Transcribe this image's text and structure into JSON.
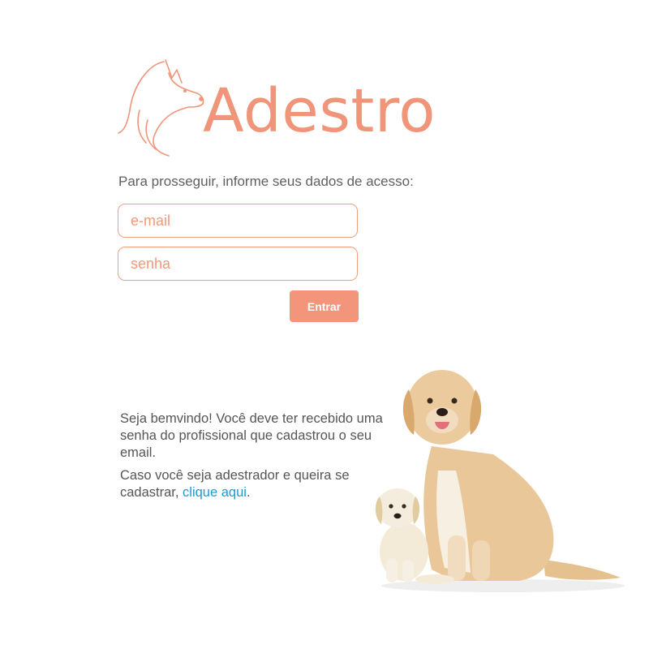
{
  "brand": {
    "name": "Adestro",
    "color": "#f0957a",
    "logo_icon": "dog-head-outline-icon"
  },
  "login": {
    "prompt": "Para prosseguir, informe seus dados de acesso:",
    "email": {
      "value": "",
      "placeholder": "e-mail"
    },
    "password": {
      "value": "",
      "placeholder": "senha"
    },
    "submit_label": "Entrar"
  },
  "welcome": {
    "paragraph1": "Seja bemvindo! Você deve ter recebido uma senha do profissional que cadastrou o seu email.",
    "paragraph2_prefix": "Caso você seja adestrador e queira se cadastrar, ",
    "register_link": "clique aqui",
    "paragraph2_suffix": ".",
    "link_color": "#1a9ad6"
  },
  "illustration": {
    "subject": "dogs-illustration"
  }
}
